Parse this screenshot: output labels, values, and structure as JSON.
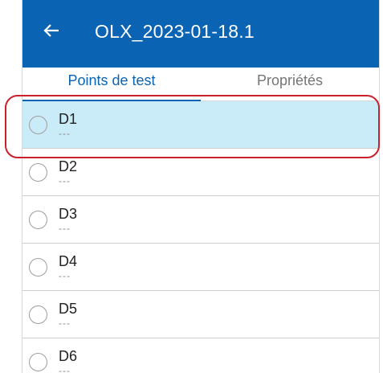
{
  "header": {
    "title": "OLX_2023-01-18.1",
    "back_icon": "arrow-left-icon",
    "background_color": "#0a63b3"
  },
  "tabs": [
    {
      "label": "Points de test",
      "active": true
    },
    {
      "label": "Propriétés",
      "active": false
    }
  ],
  "list": {
    "items": [
      {
        "label": "D1",
        "sub": "---",
        "selected": true
      },
      {
        "label": "D2",
        "sub": "---",
        "selected": false
      },
      {
        "label": "D3",
        "sub": "---",
        "selected": false
      },
      {
        "label": "D4",
        "sub": "---",
        "selected": false
      },
      {
        "label": "D5",
        "sub": "---",
        "selected": false
      },
      {
        "label": "D6",
        "sub": "---",
        "selected": false
      }
    ]
  },
  "annotation": {
    "highlight_color": "#cc1f2c"
  }
}
